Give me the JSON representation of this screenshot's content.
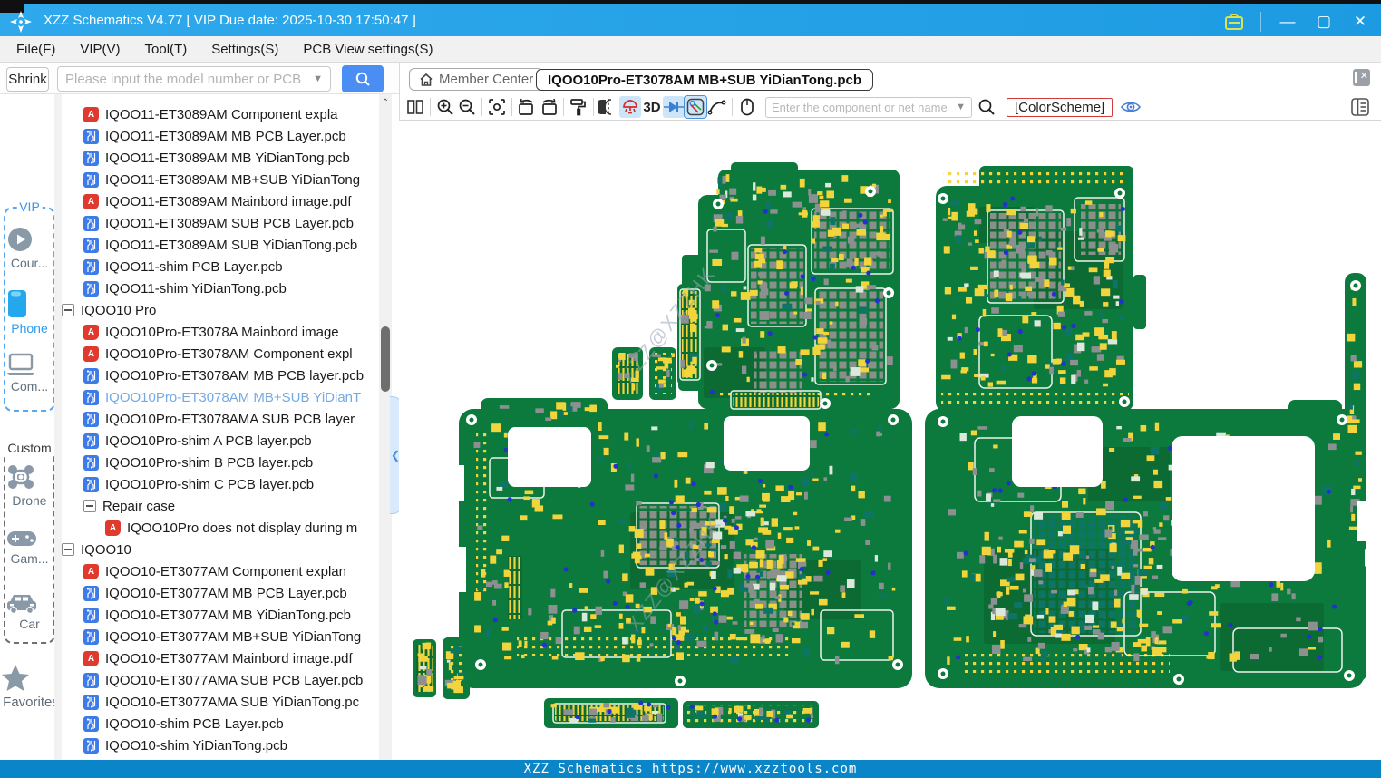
{
  "window": {
    "title": "XZZ Schematics V4.77 [ VIP Due date: 2025-10-30 17:50:47 ]",
    "control_icons": [
      "briefcase-icon",
      "minimize-icon",
      "maximize-icon",
      "close-icon"
    ],
    "minimize_glyph": "—",
    "maximize_glyph": "▢",
    "close_glyph": "✕"
  },
  "menu": {
    "items": [
      "File(F)",
      "VIP(V)",
      "Tool(T)",
      "Settings(S)",
      "PCB View settings(S)"
    ]
  },
  "search_bar": {
    "shrink_label": "Shrink",
    "placeholder": "Please input the model number or PCB",
    "search_icon": "magnifier-icon"
  },
  "tab_bar": {
    "member_center_label": "Member Center",
    "member_center_icon": "home-icon",
    "active_tab": "IQOO10Pro-ET3078AM MB+SUB YiDianTong.pcb",
    "close_panel_icon": "close-panel-icon"
  },
  "canvas_toolbar": {
    "icons": [
      "split-view-icon",
      "zoom-in-icon",
      "zoom-out-icon",
      "fit-view-icon",
      "rotate-left-icon",
      "rotate-right-icon",
      "paint-roller-icon",
      "mirror-icon",
      "lamp-icon",
      "diode-icon",
      "measure-icon",
      "curve-icon",
      "mouse-icon",
      "net-search-magnifier-icon",
      "visibility-eye-icon",
      "layers-panel-icon"
    ],
    "three_d_label": "3D",
    "net_search_placeholder": "Enter the component or net name",
    "color_scheme_label": "[ColorScheme]"
  },
  "sidebar": {
    "groups": [
      {
        "label": "VIP",
        "items": [
          {
            "label": "Cour...",
            "icon": "play-circle-icon"
          },
          {
            "label": "Phone",
            "icon": "phone-icon",
            "active": true
          },
          {
            "label": "Com...",
            "icon": "laptop-icon"
          }
        ]
      },
      {
        "label": "Custom",
        "items": [
          {
            "label": "Drone",
            "icon": "drone-icon"
          },
          {
            "label": "Gam...",
            "icon": "gamepad-icon"
          },
          {
            "label": "Car",
            "icon": "car-icon"
          }
        ]
      }
    ],
    "favorites": {
      "label": "Favorites",
      "icon": "star-icon"
    }
  },
  "tree": {
    "items": [
      {
        "type": "pdf",
        "indent": 1,
        "label": "IQOO11-ET3089AM Component expla"
      },
      {
        "type": "pcb",
        "indent": 1,
        "label": "IQOO11-ET3089AM MB PCB Layer.pcb"
      },
      {
        "type": "pcb",
        "indent": 1,
        "label": "IQOO11-ET3089AM MB YiDianTong.pcb"
      },
      {
        "type": "pcb",
        "indent": 1,
        "label": "IQOO11-ET3089AM MB+SUB YiDianTong"
      },
      {
        "type": "pdf",
        "indent": 1,
        "label": "IQOO11-ET3089AM Mainbord image.pdf"
      },
      {
        "type": "pcb",
        "indent": 1,
        "label": "IQOO11-ET3089AM SUB PCB Layer.pcb"
      },
      {
        "type": "pcb",
        "indent": 1,
        "label": "IQOO11-ET3089AM SUB YiDianTong.pcb"
      },
      {
        "type": "pcb",
        "indent": 1,
        "label": "IQOO11-shim PCB Layer.pcb"
      },
      {
        "type": "pcb",
        "indent": 1,
        "label": "IQOO11-shim YiDianTong.pcb"
      },
      {
        "type": "group",
        "indent": 0,
        "label": "IQOO10 Pro",
        "expanded": true
      },
      {
        "type": "pdf",
        "indent": 1,
        "label": "IQOO10Pro-ET3078A Mainbord image"
      },
      {
        "type": "pdf",
        "indent": 1,
        "label": "IQOO10Pro-ET3078AM Component expl"
      },
      {
        "type": "pcb",
        "indent": 1,
        "label": "IQOO10Pro-ET3078AM MB PCB layer.pcb"
      },
      {
        "type": "pcb",
        "indent": 1,
        "label": "IQOO10Pro-ET3078AM MB+SUB YiDianT",
        "selected": true
      },
      {
        "type": "pcb",
        "indent": 1,
        "label": "IQOO10Pro-ET3078AMA SUB PCB layer"
      },
      {
        "type": "pcb",
        "indent": 1,
        "label": "IQOO10Pro-shim A PCB layer.pcb"
      },
      {
        "type": "pcb",
        "indent": 1,
        "label": "IQOO10Pro-shim B PCB layer.pcb"
      },
      {
        "type": "pcb",
        "indent": 1,
        "label": "IQOO10Pro-shim C PCB layer.pcb"
      },
      {
        "type": "group",
        "indent": 1,
        "label": "Repair case",
        "expanded": true
      },
      {
        "type": "pdf",
        "indent": 2,
        "label": "IQOO10Pro does not display during m"
      },
      {
        "type": "group",
        "indent": 0,
        "label": "IQOO10",
        "expanded": true
      },
      {
        "type": "pdf",
        "indent": 1,
        "label": "IQOO10-ET3077AM Component explan"
      },
      {
        "type": "pcb",
        "indent": 1,
        "label": "IQOO10-ET3077AM MB PCB Layer.pcb"
      },
      {
        "type": "pcb",
        "indent": 1,
        "label": "IQOO10-ET3077AM MB YiDianTong.pcb"
      },
      {
        "type": "pcb",
        "indent": 1,
        "label": "IQOO10-ET3077AM MB+SUB YiDianTong"
      },
      {
        "type": "pdf",
        "indent": 1,
        "label": "IQOO10-ET3077AM Mainbord image.pdf"
      },
      {
        "type": "pcb",
        "indent": 1,
        "label": "IQOO10-ET3077AMA SUB PCB Layer.pcb"
      },
      {
        "type": "pcb",
        "indent": 1,
        "label": "IQOO10-ET3077AMA SUB YiDianTong.pc"
      },
      {
        "type": "pcb",
        "indent": 1,
        "label": "IQOO10-shim PCB Layer.pcb"
      },
      {
        "type": "pcb",
        "indent": 1,
        "label": "IQOO10-shim YiDianTong.pcb"
      }
    ]
  },
  "pcb": {
    "watermark": "XZZ@XZZHK"
  },
  "status_bar": {
    "text": "XZZ Schematics https://www.xzztools.com"
  },
  "colors": {
    "titlebar_blue": "#2FA9EC",
    "statusbar_blue": "#0A85C7",
    "accent_blue": "#4A8DF3",
    "selected_tree_item": "#74A9E2",
    "colorscheme_border_red": "#D43B3B",
    "pcb_green": "#0B7A3C",
    "pcb_dark_green": "#0B6B33",
    "pcb_pad_yellow": "#F2D53C",
    "pcb_component_gray": "#8C9090",
    "pcb_via_blue": "#2430CF",
    "pcb_teal": "#0E7566"
  }
}
